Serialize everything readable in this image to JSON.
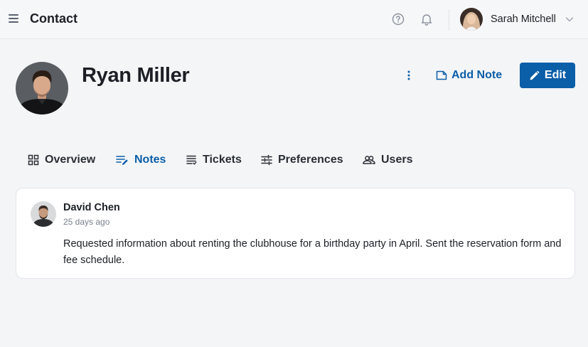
{
  "topbar": {
    "title": "Contact",
    "user_name": "Sarah Mitchell"
  },
  "contact": {
    "name": "Ryan Miller"
  },
  "actions": {
    "add_note_label": "Add Note",
    "edit_label": "Edit"
  },
  "tabs": [
    {
      "label": "Overview",
      "icon": "grid-icon",
      "active": false
    },
    {
      "label": "Notes",
      "icon": "notes-icon",
      "active": true
    },
    {
      "label": "Tickets",
      "icon": "tickets-icon",
      "active": false
    },
    {
      "label": "Preferences",
      "icon": "sliders-icon",
      "active": false
    },
    {
      "label": "Users",
      "icon": "users-icon",
      "active": false
    }
  ],
  "notes": [
    {
      "author": "David Chen",
      "time": "25 days ago",
      "body": "Requested information about renting the clubhouse for a birthday party in April. Sent the reservation form and fee schedule."
    }
  ],
  "colors": {
    "accent": "#0b5ea8",
    "text": "#1c1f26",
    "muted": "#7a808c",
    "background": "#f4f5f7"
  }
}
